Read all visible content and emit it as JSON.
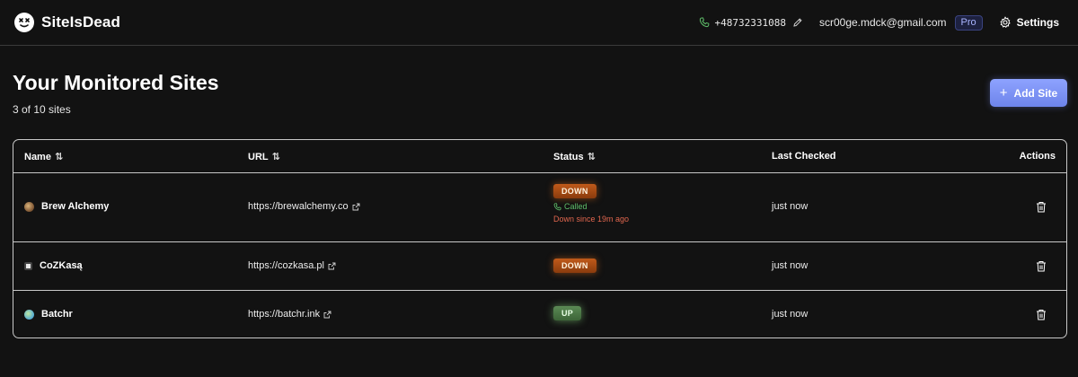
{
  "header": {
    "brand": "SiteIsDead",
    "phone": "+48732331088",
    "email": "scr00ge.mdck@gmail.com",
    "plan_badge": "Pro",
    "settings_label": "Settings"
  },
  "main": {
    "title": "Your Monitored Sites",
    "count": "3 of 10 sites",
    "add_button": "Add Site"
  },
  "table": {
    "columns": {
      "name": "Name",
      "url": "URL",
      "status": "Status",
      "last_checked": "Last Checked",
      "actions": "Actions"
    },
    "sort_glyph": "⇅",
    "rows": [
      {
        "name": "Brew Alchemy",
        "url": "https://brewalchemy.co",
        "status": "DOWN",
        "call_status": "Called",
        "down_since": "Down since 19m ago",
        "last_checked": "just now"
      },
      {
        "name": "CoZKasą",
        "url": "https://cozkasa.pl",
        "status": "DOWN",
        "last_checked": "just now"
      },
      {
        "name": "Batchr",
        "url": "https://batchr.ink",
        "status": "UP",
        "last_checked": "just now"
      }
    ]
  },
  "colors": {
    "background": "#121212",
    "accent": "#7b8ff5",
    "down": "#a0460f",
    "up": "#4d7a47",
    "called": "#5fbf6a",
    "down_since": "#e0664e"
  }
}
